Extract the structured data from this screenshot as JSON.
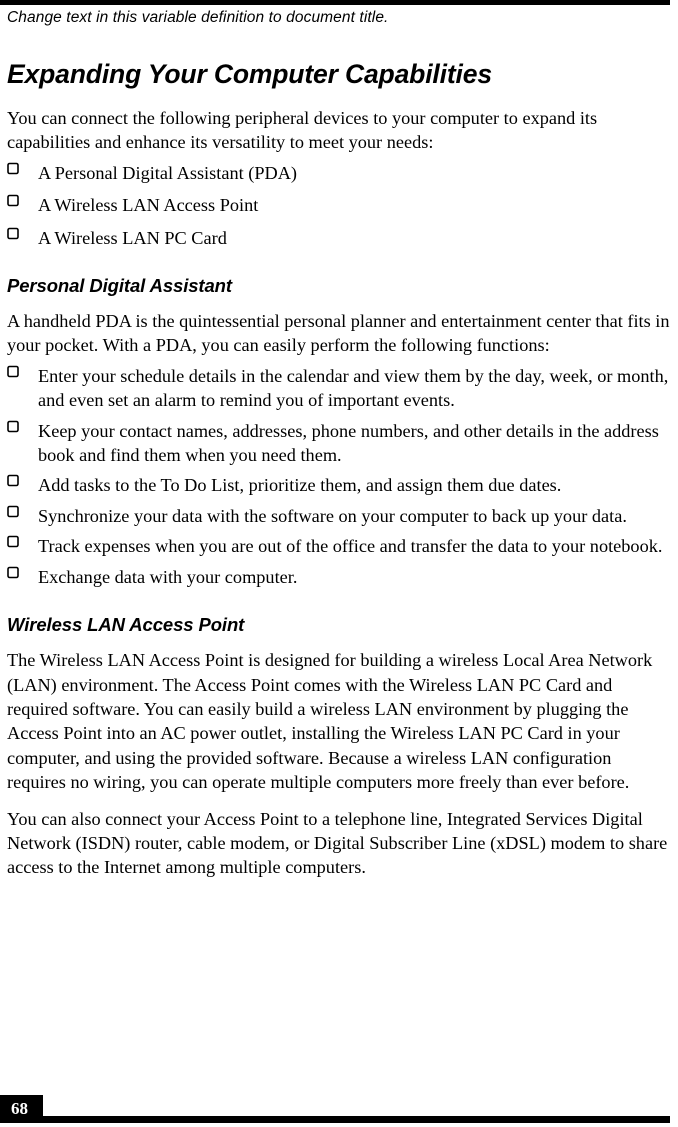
{
  "header": {
    "note": "Change text in this variable definition to document title."
  },
  "page": {
    "title": "Expanding Your Computer Capabilities",
    "intro": "You can connect the following peripheral devices to your computer to expand its capabilities and enhance its versatility to meet your needs:",
    "intro_items": [
      "A Personal Digital Assistant (PDA)",
      "A Wireless LAN Access Point",
      "A Wireless LAN PC Card"
    ],
    "sections": [
      {
        "heading": "Personal Digital Assistant",
        "intro": "A handheld PDA is the quintessential personal planner and entertainment center that fits in your pocket. With a PDA, you can easily perform the following functions:",
        "items": [
          "Enter your schedule details in the calendar and view them by the day, week, or month, and even set an alarm to remind you of important events.",
          "Keep your contact names, addresses, phone numbers, and other details in the address book and find them when you need them.",
          "Add tasks to the To Do List, prioritize them, and assign them due dates.",
          "Synchronize your data with the software on your computer to back up your data.",
          "Track expenses when you are out of the office and transfer the data to your notebook.",
          "Exchange data with your computer."
        ]
      },
      {
        "heading": "Wireless LAN Access Point",
        "paragraphs": [
          "The Wireless LAN Access Point is designed for building a wireless Local Area Network (LAN) environment. The Access Point comes with the Wireless LAN PC Card and required software. You can easily build a wireless LAN environment by plugging the Access Point into an AC power outlet, installing the Wireless LAN PC Card in your computer, and using the provided software. Because a wireless LAN configuration requires no wiring, you can operate multiple computers more freely than ever before.",
          "You can also connect your Access Point to a telephone line, Integrated Services Digital Network (ISDN) router, cable modem, or Digital Subscriber Line (xDSL) modem to share access to the Internet among multiple computers."
        ]
      }
    ]
  },
  "footer": {
    "page_number": "68"
  },
  "colors": {
    "ink": "#000000",
    "paper": "#ffffff"
  }
}
